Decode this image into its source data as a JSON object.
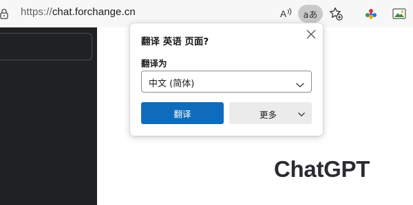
{
  "browser": {
    "url_scheme": "https://",
    "url_host": "chat.forchange.cn",
    "read_aloud_icon_text": "A",
    "translate_icon_text": "aあ"
  },
  "page": {
    "heading": "ChatGPT"
  },
  "translate_popup": {
    "title": "翻译 英语 页面?",
    "target_label": "翻译为",
    "target_language": "中文 (简体)",
    "translate_button": "翻译",
    "more_button": "更多"
  },
  "colors": {
    "sidebar_bg": "#202123",
    "primary_button": "#0f6cbd",
    "heading_text": "#2a2b32"
  }
}
